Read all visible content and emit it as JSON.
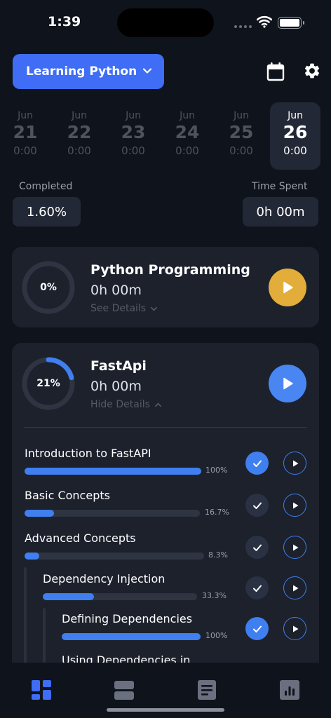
{
  "status_bar": {
    "time": "1:39"
  },
  "header": {
    "course_label": "Learning Python"
  },
  "dates": [
    {
      "month": "Jun",
      "day": "21",
      "time": "0:00",
      "active": false
    },
    {
      "month": "Jun",
      "day": "22",
      "time": "0:00",
      "active": false
    },
    {
      "month": "Jun",
      "day": "23",
      "time": "0:00",
      "active": false
    },
    {
      "month": "Jun",
      "day": "24",
      "time": "0:00",
      "active": false
    },
    {
      "month": "Jun",
      "day": "25",
      "time": "0:00",
      "active": false
    },
    {
      "month": "Jun",
      "day": "26",
      "time": "0:00",
      "active": true
    }
  ],
  "stats": {
    "completed_label": "Completed",
    "completed_value": "1.60%",
    "time_label": "Time Spent",
    "time_value": "0h 00m"
  },
  "courses": [
    {
      "title": "Python Programming",
      "progress_label": "0%",
      "progress": 0,
      "time": "0h 00m",
      "toggle_label": "See Details",
      "play_color": "#e2ad3b"
    },
    {
      "title": "FastApi",
      "progress_label": "21%",
      "progress": 0.21,
      "time": "0h 00m",
      "toggle_label": "Hide Details",
      "play_color": "#4a86f2",
      "lessons": [
        {
          "name": "Introduction to FastAPI",
          "pct_label": "100%",
          "progress": 1.0,
          "done": true
        },
        {
          "name": "Basic Concepts",
          "pct_label": "16.7%",
          "progress": 0.167,
          "done": false
        },
        {
          "name": "Advanced Concepts",
          "pct_label": "8.3%",
          "progress": 0.083,
          "done": false
        },
        {
          "name": "Dependency Injection",
          "pct_label": "33.3%",
          "progress": 0.333,
          "done": false
        },
        {
          "name": "Defining Dependencies",
          "pct_label": "100%",
          "progress": 1.0,
          "done": true
        },
        {
          "name": "Using Dependencies in",
          "pct_label": "",
          "progress": 0,
          "done": false
        }
      ]
    }
  ],
  "colors": {
    "accent": "#3f6df5",
    "progress": "#3f7ff0",
    "background": "#0f131b",
    "card": "#1c212c"
  },
  "tabbar": {
    "icons": [
      "dashboard-icon",
      "courses-icon",
      "notes-icon",
      "stats-icon"
    ],
    "active_index": 0
  }
}
